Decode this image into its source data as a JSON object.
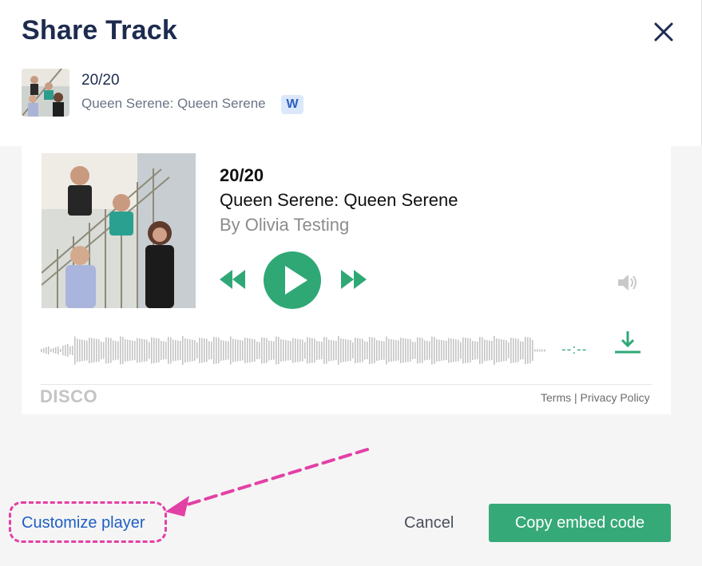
{
  "header": {
    "title": "Share Track",
    "track_title": "20/20",
    "track_subtitle": "Queen Serene: Queen Serene",
    "badge": "W"
  },
  "player": {
    "title": "20/20",
    "subtitle": "Queen Serene: Queen Serene",
    "artist": "By Olivia Testing",
    "time": "--:--",
    "brand": "DISCO",
    "terms": "Terms",
    "separator": "|",
    "privacy": "Privacy Policy"
  },
  "footer": {
    "customize_label": "Customize player",
    "cancel_label": "Cancel",
    "copy_label": "Copy embed code"
  },
  "colors": {
    "accent_green": "#2fa876",
    "title_navy": "#1d2b4f",
    "link_blue": "#1f5fc4",
    "annotation_pink": "#e340a6"
  },
  "icons": [
    "close-icon",
    "rewind-icon",
    "play-icon",
    "fast-forward-icon",
    "volume-icon",
    "download-icon"
  ]
}
